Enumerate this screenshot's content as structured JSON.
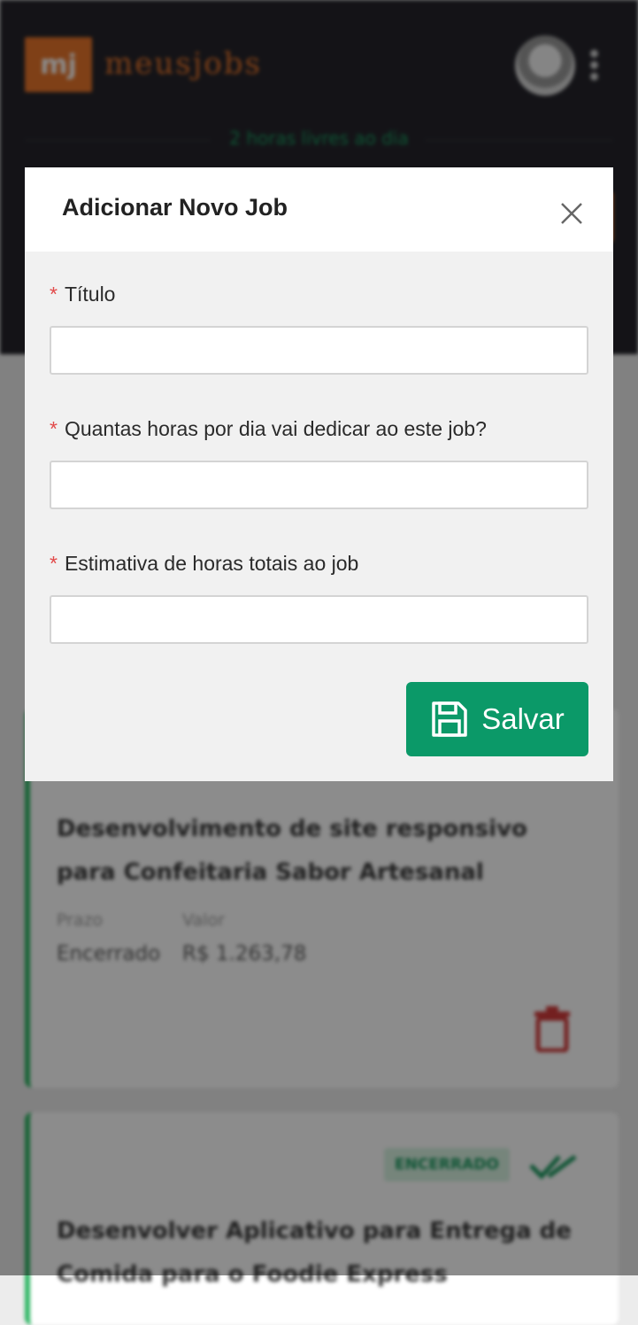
{
  "header": {
    "logo_mark": "mj",
    "logo_text": "meusjobs",
    "free_hours": "2 horas livres ao dia"
  },
  "jobs": [
    {
      "title": "Desenvolvimento de site responsivo para Confeitaria Sabor Artesanal",
      "deadline_label": "Prazo",
      "deadline_value": "Encerrado",
      "value_label": "Valor",
      "value_value": "R$ 1.263,78"
    },
    {
      "status": "ENCERRADO",
      "title": "Desenvolver Aplicativo para Entrega de Comida para o Foodie Express"
    }
  ],
  "modal": {
    "title": "Adicionar Novo Job",
    "required_marker": "*",
    "fields": [
      {
        "label": "Título",
        "value": ""
      },
      {
        "label": "Quantas horas por dia vai dedicar ao este job?",
        "value": ""
      },
      {
        "label": "Estimativa de horas totais ao job",
        "value": ""
      }
    ],
    "save_label": "Salvar"
  },
  "colors": {
    "accent_orange": "#e8752a",
    "success_green": "#0b9968",
    "required_red": "#e24a4a",
    "header_dark": "#25242b"
  }
}
